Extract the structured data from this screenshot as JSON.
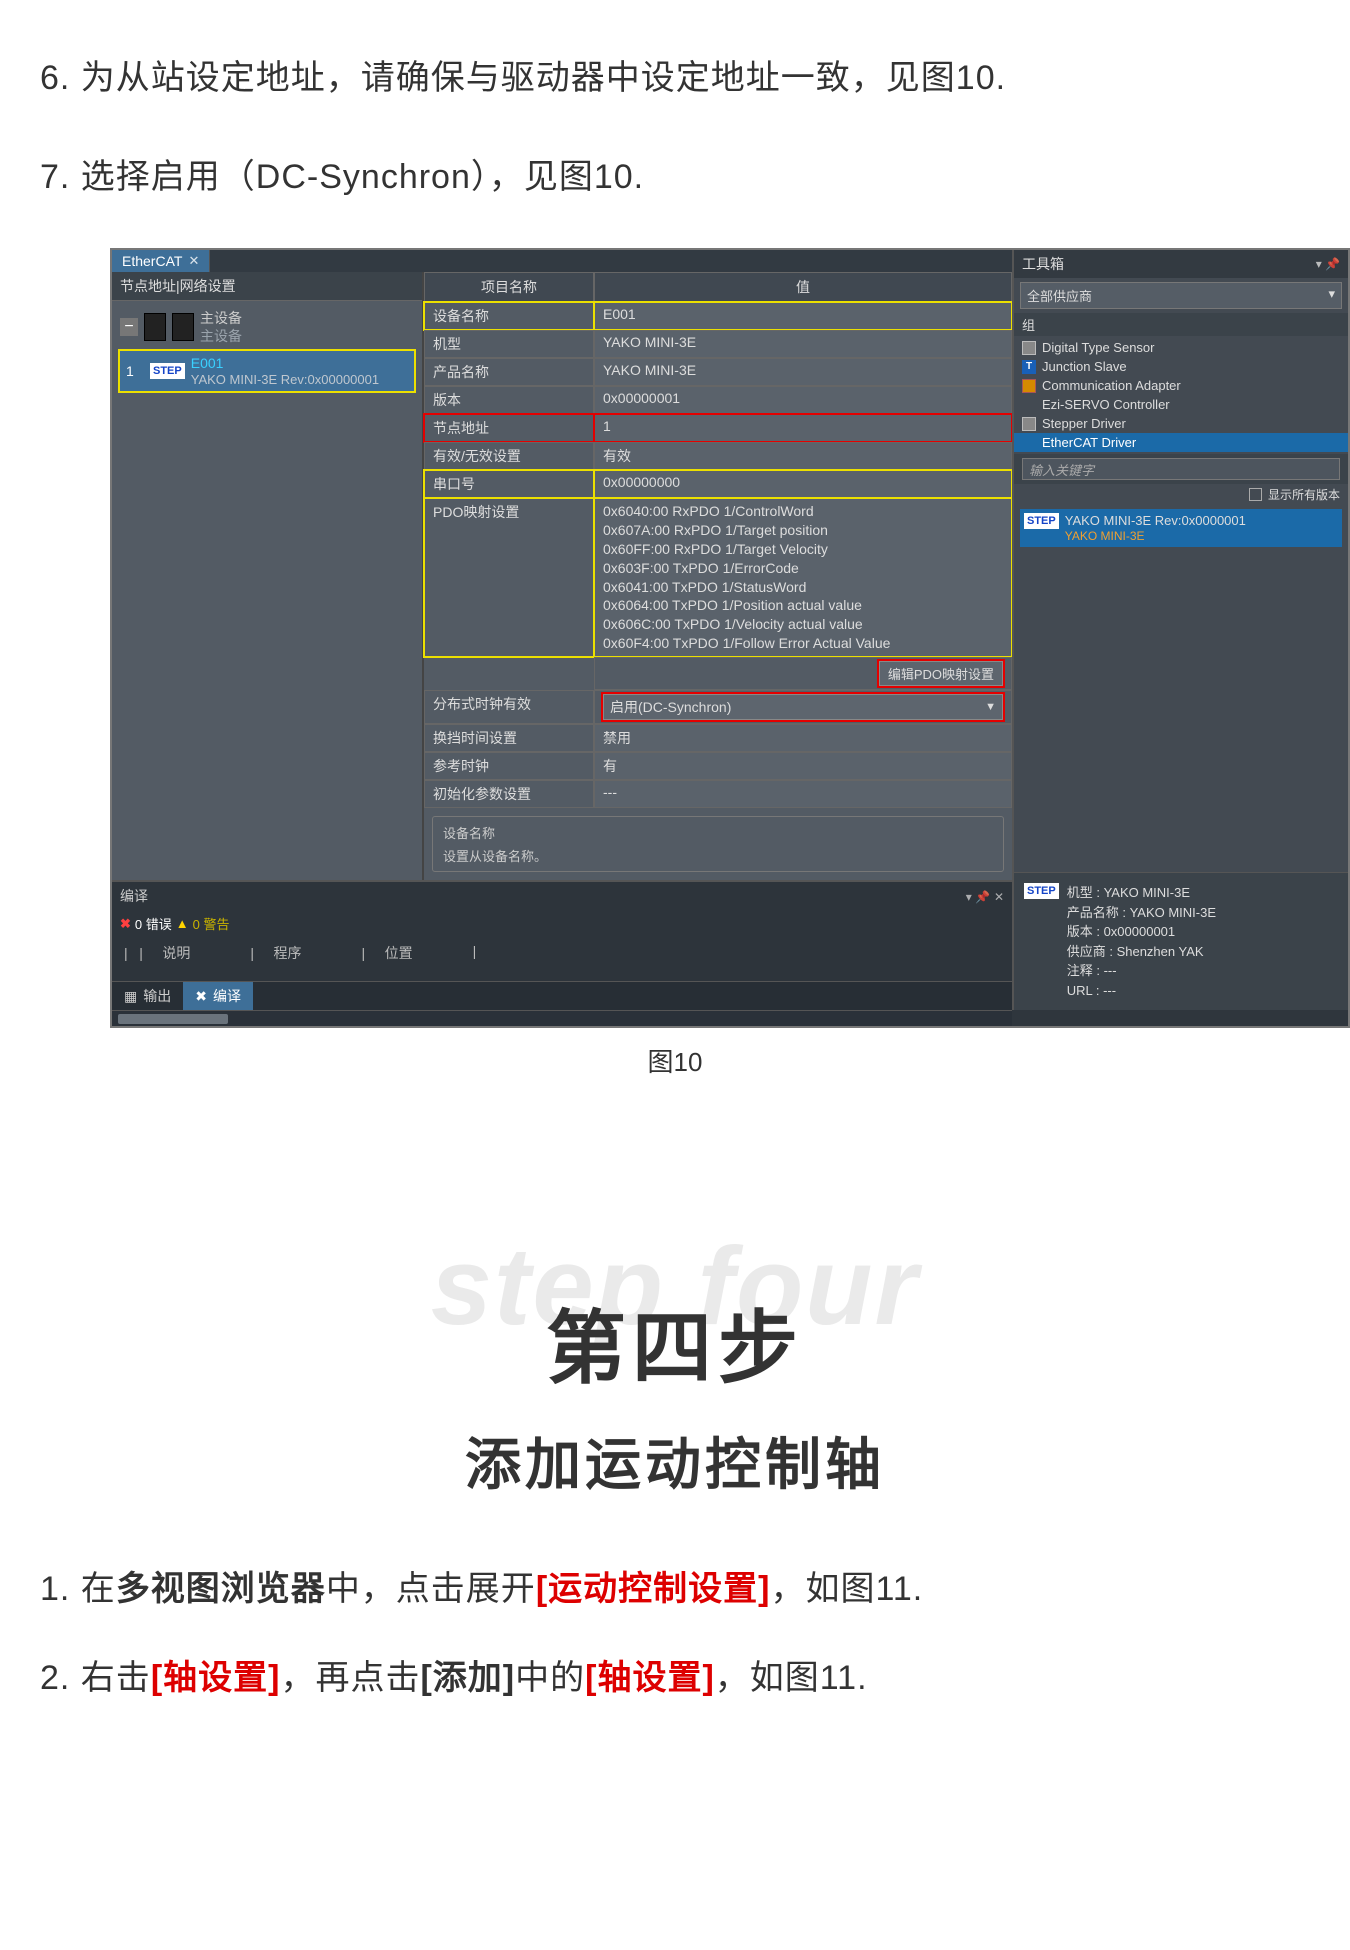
{
  "doc": {
    "line6": "6. 为从站设定地址，请确保与驱动器中设定地址一致，见图10.",
    "line7": "7. 选择启用（DC-Synchron），见图10.",
    "caption": "图10",
    "step_ghost": "step four",
    "step_cn": "第四步",
    "step_sub": "添加运动控制轴",
    "p1_pre": "1. 在",
    "p1_b1": "多视图浏览器",
    "p1_mid": "中，点击展开",
    "p1_r1": "[运动控制设置]",
    "p1_suf": "，如图11.",
    "p2_pre": "2. 右击",
    "p2_r1": "[轴设置]",
    "p2_mid": "，再点击",
    "p2_b1": "[添加]",
    "p2_mid2": "中的",
    "p2_r2": "[轴设置]",
    "p2_suf": "，如图11."
  },
  "ui": {
    "tab_label": "EtherCAT",
    "tree_header": "节点地址|网络设置",
    "master_line1": "主设备",
    "master_line2": "主设备",
    "sel_num": "1",
    "sel_code": "E001",
    "sel_desc": "YAKO MINI-3E Rev:0x00000001",
    "prop_head_name": "项目名称",
    "prop_head_val": "值",
    "props": {
      "dev_name_l": "设备名称",
      "dev_name_v": "E001",
      "model_l": "机型",
      "model_v": "YAKO MINI-3E",
      "prod_l": "产品名称",
      "prod_v": "YAKO MINI-3E",
      "ver_l": "版本",
      "ver_v": "0x00000001",
      "addr_l": "节点地址",
      "addr_v": "1",
      "valid_l": "有效/无效设置",
      "valid_v": "有效",
      "serial_l": "串口号",
      "serial_v": "0x00000000",
      "pdo_l": "PDO映射设置",
      "pdo_v": "0x6040:00 RxPDO 1/ControlWord\n0x607A:00 RxPDO 1/Target position\n0x60FF:00 RxPDO 1/Target Velocity\n0x603F:00 TxPDO 1/ErrorCode\n0x6041:00 TxPDO 1/StatusWord\n0x6064:00 TxPDO 1/Position actual value\n0x606C:00 TxPDO 1/Velocity actual value\n0x60F4:00 TxPDO 1/Follow Error Actual Value",
      "btn_edit_pdo": "编辑PDO映射设置",
      "dc_l": "分布式时钟有效",
      "dc_v": "启用(DC-Synchron)",
      "shift_l": "换挡时间设置",
      "shift_v": "禁用",
      "ref_l": "参考时钟",
      "ref_v": "有",
      "init_l": "初始化参数设置",
      "init_v": "---"
    },
    "desc_title": "设备名称",
    "desc_body": "设置从设备名称。",
    "compile_title": "编译",
    "err_count": "0 错误",
    "warn_count": "0 警告",
    "col_desc": "说明",
    "col_prog": "程序",
    "col_pos": "位置",
    "tab_out": "输出",
    "tab_compile": "编译",
    "toolbox_title": "工具箱",
    "supplier": "全部供应商",
    "grp": "组",
    "items": {
      "i1": "Digital Type Sensor",
      "i2": "Junction Slave",
      "i3": "Communication Adapter",
      "i4": "Ezi-SERVO Controller",
      "i5": "Stepper Driver",
      "i6": "EtherCAT Driver"
    },
    "kw_label": "输入关键字",
    "show_all": "显示所有版本",
    "result_title": "YAKO MINI-3E Rev:0x0000001",
    "result_sub": "YAKO MINI-3E",
    "info": {
      "l1": "机型 : YAKO MINI-3E",
      "l2": "产品名称 : YAKO MINI-3E",
      "l3": "版本 : 0x00000001",
      "l4": "供应商 : Shenzhen YAK",
      "l5": "注释 : ---",
      "l6": "URL : ---"
    }
  }
}
